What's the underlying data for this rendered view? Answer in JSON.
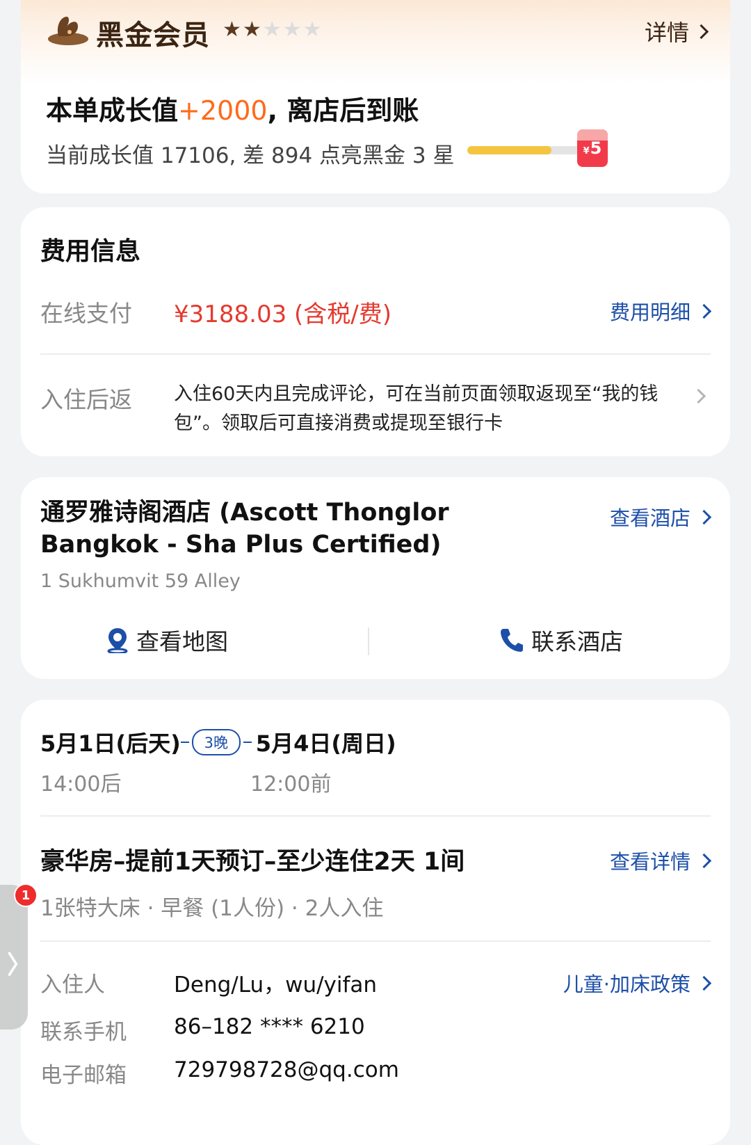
{
  "member": {
    "title": "黑金会员",
    "stars_filled": 2,
    "stars_total": 5,
    "detail_label": "详情",
    "growth_prefix": "本单成长值",
    "growth_amount": "+2000",
    "growth_suffix": ", 离店后到账",
    "growth_sub": "当前成长值 17106, 差 894 点亮黑金 3 星",
    "progress": 0.74,
    "reward_amount": "5",
    "reward_currency": "¥"
  },
  "fee": {
    "title": "费用信息",
    "online_label": "在线支付",
    "online_value": "¥3188.03 (含税/费)",
    "detail_link": "费用明细",
    "cashback_label": "入住后返",
    "cashback_text": "入住60天内且完成评论，可在当前页面领取返现至“我的钱包”。领取后可直接消费或提现至银行卡"
  },
  "hotel": {
    "name": "通罗雅诗阁酒店 (Ascott Thonglor Bangkok - Sha Plus Certified)",
    "view_link": "查看酒店",
    "address": "1 Sukhumvit 59 Alley",
    "map_label": "查看地图",
    "contact_label": "联系酒店"
  },
  "booking": {
    "checkin_date": "5月1日(后天)",
    "nights": "3晚",
    "checkout_date": "5月4日(周日)",
    "checkin_time": "14:00后",
    "checkout_time": "12:00前",
    "room_title": "豪华房–提前1天预订–至少连住2天 1间",
    "room_link": "查看详情",
    "room_sub": "1张特大床 · 早餐 (1人份) · 2人入住",
    "guest_label": "入住人",
    "guest_value": "Deng/Lu，wu/yifan",
    "policy_link": "儿童·加床政策",
    "phone_label": "联系手机",
    "phone_value": "86–182 **** 6210",
    "email_label": "电子邮箱",
    "email_value": "729798728@qq.com"
  },
  "side_badge": "1",
  "colors": {
    "accent_blue": "#1d4fa8",
    "price_red": "#e43a2f",
    "growth_orange": "#ff6a1a",
    "member_brown": "#3c2412"
  }
}
